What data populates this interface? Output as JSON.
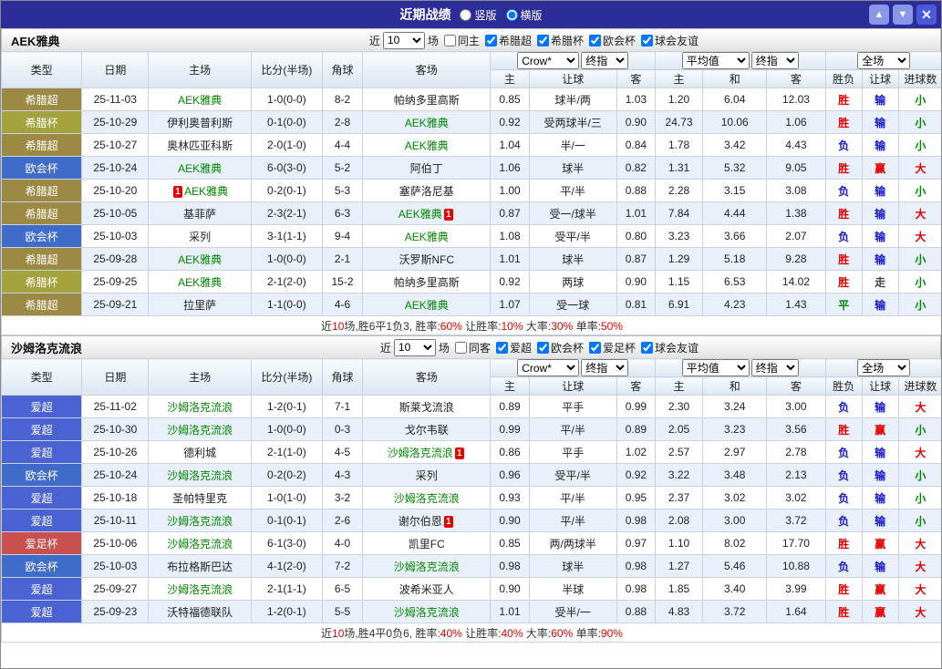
{
  "titlebar": {
    "title": "近期战绩",
    "layout_options": [
      {
        "label": "竖版",
        "selected": false
      },
      {
        "label": "横版",
        "selected": true
      }
    ],
    "up_icon": "▲",
    "down_icon": "▼",
    "close_icon": "✕"
  },
  "palette": {
    "red": "#e60000",
    "blue": "#1515cc",
    "green": "#008800",
    "dark": "#444444",
    "text": "#333333"
  },
  "columns": {
    "main": [
      "类型",
      "日期",
      "主场",
      "比分(半场)",
      "角球",
      "客场"
    ],
    "odds_group": [
      "主",
      "让球",
      "客"
    ],
    "avg_group": [
      "主",
      "和",
      "客"
    ],
    "result_group": [
      "胜负",
      "让球",
      "进球数"
    ],
    "selects": {
      "bookmaker": "Crow*",
      "final": "终指",
      "average": "平均值",
      "scope": "全场"
    }
  },
  "sections": [
    {
      "team": "AEK雅典",
      "filter": {
        "near_label": "近",
        "count": "10",
        "matches_label": "场",
        "same_venue_label": "同主",
        "same_venue_checked": false,
        "leagues": [
          {
            "label": "希腊超",
            "checked": true
          },
          {
            "label": "希腊杯",
            "checked": true
          },
          {
            "label": "欧会杯",
            "checked": true
          },
          {
            "label": "球会友谊",
            "checked": true
          }
        ]
      },
      "rows": [
        {
          "league": "希腊超",
          "lc": "#9c8a44",
          "date": "25-11-03",
          "home": {
            "name": "AEK雅典",
            "green": true
          },
          "score": "1-0(0-0)",
          "corner": "8-2",
          "away": {
            "name": "帕纳多里高斯"
          },
          "odds": [
            "0.85",
            "球半/两",
            "1.03"
          ],
          "avg": [
            "1.20",
            "6.04",
            "12.03"
          ],
          "res": [
            [
              "胜",
              "red"
            ],
            [
              "输",
              "blue"
            ],
            [
              "小",
              "green"
            ]
          ]
        },
        {
          "league": "希腊杯",
          "lc": "#a4a23c",
          "date": "25-10-29",
          "home": {
            "name": "伊利奥普利斯"
          },
          "score": "0-1(0-0)",
          "corner": "2-8",
          "away": {
            "name": "AEK雅典",
            "green": true
          },
          "odds": [
            "0.92",
            "受两球半/三",
            "0.90"
          ],
          "avg": [
            "24.73",
            "10.06",
            "1.06"
          ],
          "res": [
            [
              "胜",
              "red"
            ],
            [
              "输",
              "blue"
            ],
            [
              "小",
              "green"
            ]
          ]
        },
        {
          "league": "希腊超",
          "lc": "#9c8a44",
          "date": "25-10-27",
          "home": {
            "name": "奥林匹亚科斯"
          },
          "score": "2-0(1-0)",
          "corner": "4-4",
          "away": {
            "name": "AEK雅典",
            "green": true
          },
          "odds": [
            "1.04",
            "半/一",
            "0.84"
          ],
          "avg": [
            "1.78",
            "3.42",
            "4.43"
          ],
          "res": [
            [
              "负",
              "blue"
            ],
            [
              "输",
              "blue"
            ],
            [
              "小",
              "green"
            ]
          ]
        },
        {
          "league": "欧会杯",
          "lc": "#3f6cc8",
          "date": "25-10-24",
          "home": {
            "name": "AEK雅典",
            "green": true
          },
          "score": "6-0(3-0)",
          "corner": "5-2",
          "away": {
            "name": "阿伯丁"
          },
          "odds": [
            "1.06",
            "球半",
            "0.82"
          ],
          "avg": [
            "1.31",
            "5.32",
            "9.05"
          ],
          "res": [
            [
              "胜",
              "red"
            ],
            [
              "赢",
              "red"
            ],
            [
              "大",
              "red"
            ]
          ]
        },
        {
          "league": "希腊超",
          "lc": "#9c8a44",
          "date": "25-10-20",
          "home": {
            "name": "AEK雅典",
            "green": true,
            "rc": "before"
          },
          "score": "0-2(0-1)",
          "corner": "5-3",
          "away": {
            "name": "塞萨洛尼基"
          },
          "odds": [
            "1.00",
            "平/半",
            "0.88"
          ],
          "avg": [
            "2.28",
            "3.15",
            "3.08"
          ],
          "res": [
            [
              "负",
              "blue"
            ],
            [
              "输",
              "blue"
            ],
            [
              "小",
              "green"
            ]
          ]
        },
        {
          "league": "希腊超",
          "lc": "#9c8a44",
          "date": "25-10-05",
          "home": {
            "name": "基菲萨"
          },
          "score": "2-3(2-1)",
          "corner": "6-3",
          "away": {
            "name": "AEK雅典",
            "green": true,
            "rc": "after"
          },
          "odds": [
            "0.87",
            "受一/球半",
            "1.01"
          ],
          "avg": [
            "7.84",
            "4.44",
            "1.38"
          ],
          "res": [
            [
              "胜",
              "red"
            ],
            [
              "输",
              "blue"
            ],
            [
              "大",
              "red"
            ]
          ]
        },
        {
          "league": "欧会杯",
          "lc": "#3f6cc8",
          "date": "25-10-03",
          "home": {
            "name": "采列"
          },
          "score": "3-1(1-1)",
          "corner": "9-4",
          "away": {
            "name": "AEK雅典",
            "green": true
          },
          "odds": [
            "1.08",
            "受平/半",
            "0.80"
          ],
          "avg": [
            "3.23",
            "3.66",
            "2.07"
          ],
          "res": [
            [
              "负",
              "blue"
            ],
            [
              "输",
              "blue"
            ],
            [
              "大",
              "red"
            ]
          ]
        },
        {
          "league": "希腊超",
          "lc": "#9c8a44",
          "date": "25-09-28",
          "home": {
            "name": "AEK雅典",
            "green": true
          },
          "score": "1-0(0-0)",
          "corner": "2-1",
          "away": {
            "name": "沃罗斯NFC"
          },
          "odds": [
            "1.01",
            "球半",
            "0.87"
          ],
          "avg": [
            "1.29",
            "5.18",
            "9.28"
          ],
          "res": [
            [
              "胜",
              "red"
            ],
            [
              "输",
              "blue"
            ],
            [
              "小",
              "green"
            ]
          ]
        },
        {
          "league": "希腊杯",
          "lc": "#a4a23c",
          "date": "25-09-25",
          "home": {
            "name": "AEK雅典",
            "green": true
          },
          "score": "2-1(2-0)",
          "corner": "15-2",
          "away": {
            "name": "帕纳多里高斯"
          },
          "odds": [
            "0.92",
            "两球",
            "0.90"
          ],
          "avg": [
            "1.15",
            "6.53",
            "14.02"
          ],
          "res": [
            [
              "胜",
              "red"
            ],
            [
              "走",
              "dark"
            ],
            [
              "小",
              "green"
            ]
          ]
        },
        {
          "league": "希腊超",
          "lc": "#9c8a44",
          "date": "25-09-21",
          "home": {
            "name": "拉里萨"
          },
          "score": "1-1(0-0)",
          "corner": "4-6",
          "away": {
            "name": "AEK雅典",
            "green": true
          },
          "odds": [
            "1.07",
            "受一球",
            "0.81"
          ],
          "avg": [
            "6.91",
            "4.23",
            "1.43"
          ],
          "res": [
            [
              "平",
              "green"
            ],
            [
              "输",
              "blue"
            ],
            [
              "小",
              "green"
            ]
          ]
        }
      ],
      "summary": [
        [
          "近",
          "dark"
        ],
        [
          "10",
          "red"
        ],
        [
          "场,胜6平1负3, ",
          "dark"
        ],
        [
          "胜率:",
          "dark"
        ],
        [
          "60%",
          "red"
        ],
        [
          " 让胜率:",
          "dark"
        ],
        [
          "10%",
          "red"
        ],
        [
          " 大率:",
          "dark"
        ],
        [
          "30%",
          "red"
        ],
        [
          " 单率:",
          "dark"
        ],
        [
          "50%",
          "red"
        ]
      ]
    },
    {
      "team": "沙姆洛克流浪",
      "filter": {
        "near_label": "近",
        "count": "10",
        "matches_label": "场",
        "same_venue_label": "同客",
        "same_venue_checked": false,
        "leagues": [
          {
            "label": "爱超",
            "checked": true
          },
          {
            "label": "欧会杯",
            "checked": true
          },
          {
            "label": "爱足杯",
            "checked": true
          },
          {
            "label": "球会友谊",
            "checked": true
          }
        ]
      },
      "rows": [
        {
          "league": "爱超",
          "lc": "#4b63d2",
          "date": "25-11-02",
          "home": {
            "name": "沙姆洛克流浪",
            "green": true
          },
          "score": "1-2(0-1)",
          "corner": "7-1",
          "away": {
            "name": "斯莱戈流浪"
          },
          "odds": [
            "0.89",
            "平手",
            "0.99"
          ],
          "avg": [
            "2.30",
            "3.24",
            "3.00"
          ],
          "res": [
            [
              "负",
              "blue"
            ],
            [
              "输",
              "blue"
            ],
            [
              "大",
              "red"
            ]
          ]
        },
        {
          "league": "爱超",
          "lc": "#4b63d2",
          "date": "25-10-30",
          "home": {
            "name": "沙姆洛克流浪",
            "green": true
          },
          "score": "1-0(0-0)",
          "corner": "0-3",
          "away": {
            "name": "戈尔韦联"
          },
          "odds": [
            "0.99",
            "平/半",
            "0.89"
          ],
          "avg": [
            "2.05",
            "3.23",
            "3.56"
          ],
          "res": [
            [
              "胜",
              "red"
            ],
            [
              "赢",
              "red"
            ],
            [
              "小",
              "green"
            ]
          ]
        },
        {
          "league": "爱超",
          "lc": "#4b63d2",
          "date": "25-10-26",
          "home": {
            "name": "德利城"
          },
          "score": "2-1(1-0)",
          "corner": "4-5",
          "away": {
            "name": "沙姆洛克流浪",
            "green": true,
            "rc": "after"
          },
          "odds": [
            "0.86",
            "平手",
            "1.02"
          ],
          "avg": [
            "2.57",
            "2.97",
            "2.78"
          ],
          "res": [
            [
              "负",
              "blue"
            ],
            [
              "输",
              "blue"
            ],
            [
              "大",
              "red"
            ]
          ]
        },
        {
          "league": "欧会杯",
          "lc": "#3f6cc8",
          "date": "25-10-24",
          "home": {
            "name": "沙姆洛克流浪",
            "green": true
          },
          "score": "0-2(0-2)",
          "corner": "4-3",
          "away": {
            "name": "采列"
          },
          "odds": [
            "0.96",
            "受平/半",
            "0.92"
          ],
          "avg": [
            "3.22",
            "3.48",
            "2.13"
          ],
          "res": [
            [
              "负",
              "blue"
            ],
            [
              "输",
              "blue"
            ],
            [
              "小",
              "green"
            ]
          ]
        },
        {
          "league": "爱超",
          "lc": "#4b63d2",
          "date": "25-10-18",
          "home": {
            "name": "圣帕特里克"
          },
          "score": "1-0(1-0)",
          "corner": "3-2",
          "away": {
            "name": "沙姆洛克流浪",
            "green": true
          },
          "odds": [
            "0.93",
            "平/半",
            "0.95"
          ],
          "avg": [
            "2.37",
            "3.02",
            "3.02"
          ],
          "res": [
            [
              "负",
              "blue"
            ],
            [
              "输",
              "blue"
            ],
            [
              "小",
              "green"
            ]
          ]
        },
        {
          "league": "爱超",
          "lc": "#4b63d2",
          "date": "25-10-11",
          "home": {
            "name": "沙姆洛克流浪",
            "green": true
          },
          "score": "0-1(0-1)",
          "corner": "2-6",
          "away": {
            "name": "谢尔伯恩",
            "rc": "after"
          },
          "odds": [
            "0.90",
            "平/半",
            "0.98"
          ],
          "avg": [
            "2.08",
            "3.00",
            "3.72"
          ],
          "res": [
            [
              "负",
              "blue"
            ],
            [
              "输",
              "blue"
            ],
            [
              "小",
              "green"
            ]
          ]
        },
        {
          "league": "爱足杯",
          "lc": "#c8504f",
          "date": "25-10-06",
          "home": {
            "name": "沙姆洛克流浪",
            "green": true
          },
          "score": "6-1(3-0)",
          "corner": "4-0",
          "away": {
            "name": "凯里FC"
          },
          "odds": [
            "0.85",
            "两/两球半",
            "0.97"
          ],
          "avg": [
            "1.10",
            "8.02",
            "17.70"
          ],
          "res": [
            [
              "胜",
              "red"
            ],
            [
              "赢",
              "red"
            ],
            [
              "大",
              "red"
            ]
          ]
        },
        {
          "league": "欧会杯",
          "lc": "#3f6cc8",
          "date": "25-10-03",
          "home": {
            "name": "布拉格斯巴达"
          },
          "score": "4-1(2-0)",
          "corner": "7-2",
          "away": {
            "name": "沙姆洛克流浪",
            "green": true
          },
          "odds": [
            "0.98",
            "球半",
            "0.98"
          ],
          "avg": [
            "1.27",
            "5.46",
            "10.88"
          ],
          "res": [
            [
              "负",
              "blue"
            ],
            [
              "输",
              "blue"
            ],
            [
              "大",
              "red"
            ]
          ]
        },
        {
          "league": "爱超",
          "lc": "#4b63d2",
          "date": "25-09-27",
          "home": {
            "name": "沙姆洛克流浪",
            "green": true
          },
          "score": "2-1(1-1)",
          "corner": "6-5",
          "away": {
            "name": "波希米亚人"
          },
          "odds": [
            "0.90",
            "半球",
            "0.98"
          ],
          "avg": [
            "1.85",
            "3.40",
            "3.99"
          ],
          "res": [
            [
              "胜",
              "red"
            ],
            [
              "赢",
              "red"
            ],
            [
              "大",
              "red"
            ]
          ]
        },
        {
          "league": "爱超",
          "lc": "#4b63d2",
          "date": "25-09-23",
          "home": {
            "name": "沃特福德联队"
          },
          "score": "1-2(0-1)",
          "corner": "5-5",
          "away": {
            "name": "沙姆洛克流浪",
            "green": true
          },
          "odds": [
            "1.01",
            "受半/一",
            "0.88"
          ],
          "avg": [
            "4.83",
            "3.72",
            "1.64"
          ],
          "res": [
            [
              "胜",
              "red"
            ],
            [
              "赢",
              "red"
            ],
            [
              "大",
              "red"
            ]
          ]
        }
      ],
      "summary": [
        [
          "近",
          "dark"
        ],
        [
          "10",
          "red"
        ],
        [
          "场,胜4平0负6, ",
          "dark"
        ],
        [
          "胜率:",
          "dark"
        ],
        [
          "40%",
          "red"
        ],
        [
          " 让胜率:",
          "dark"
        ],
        [
          "40%",
          "red"
        ],
        [
          " 大率:",
          "dark"
        ],
        [
          "60%",
          "red"
        ],
        [
          " 单率:",
          "dark"
        ],
        [
          "90%",
          "red"
        ]
      ]
    }
  ]
}
